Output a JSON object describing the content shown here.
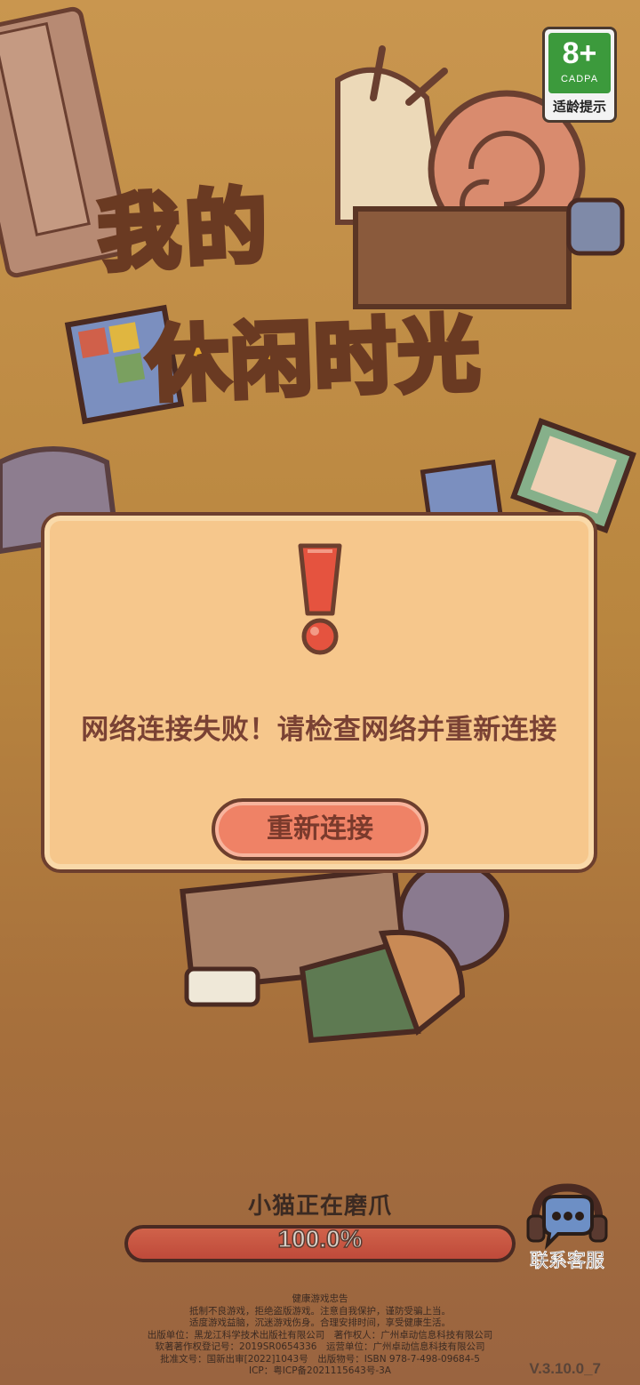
{
  "age_rating": {
    "number": "8+",
    "org": "CADPA",
    "tip": "适龄提示"
  },
  "game_title": {
    "line1": "我的",
    "line2": "休闲时光"
  },
  "dialog": {
    "message": "网络连接失败！请检查网络并重新连接",
    "button_label": "重新连接"
  },
  "loading": {
    "status_text": "小猫正在磨爪",
    "progress_value": 1.0,
    "progress_label": "100.0%"
  },
  "support": {
    "label": "联系客服"
  },
  "footer": {
    "lines": [
      "健康游戏忠告",
      "抵制不良游戏，拒绝盗版游戏。注意自我保护，谨防受骗上当。",
      "适度游戏益脑，沉迷游戏伤身。合理安排时间，享受健康生活。",
      "出版单位：黑龙江科学技术出版社有限公司　著作权人：广州卓动信息科技有限公司",
      "软著著作权登记号：2019SR0654336　运营单位：广州卓动信息科技有限公司",
      "批准文号：国新出审[2022]1043号　出版物号：ISBN 978-7-498-09684-5",
      "ICP：粤ICP备2021115643号-3A"
    ]
  },
  "version": "V.3.10.0_7",
  "colors": {
    "dialog_bg": "#f6c78c",
    "button_bg": "#ef8266",
    "outline": "#6d3f2e",
    "progress_fill": "#c9553f"
  }
}
